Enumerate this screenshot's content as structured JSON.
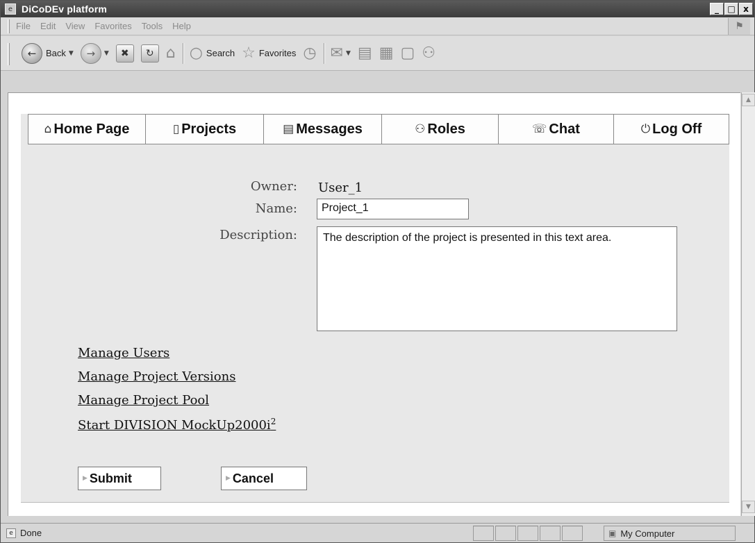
{
  "window": {
    "title": "DiCoDEv platform",
    "controls": {
      "minimize": "_",
      "restore": "□",
      "close": "x"
    }
  },
  "menu": [
    "File",
    "Edit",
    "View",
    "Favorites",
    "Tools",
    "Help"
  ],
  "toolbar": {
    "back_label": "Back",
    "search_label": "Search",
    "favorites_label": "Favorites"
  },
  "tabs": [
    {
      "label": "Home Page",
      "icon": "home-icon"
    },
    {
      "label": "Projects",
      "icon": "document-icon"
    },
    {
      "label": "Messages",
      "icon": "list-icon"
    },
    {
      "label": "Roles",
      "icon": "people-icon"
    },
    {
      "label": "Chat",
      "icon": "chat-icon"
    },
    {
      "label": "Log Off",
      "icon": "power-icon"
    }
  ],
  "form": {
    "owner_label": "Owner:",
    "owner_value": "User_1",
    "name_label": "Name:",
    "name_value": "Project_1",
    "description_label": "Description:",
    "description_value": "The description of the project is presented in this text area."
  },
  "links": {
    "manage_users": "Manage Users",
    "manage_versions": "Manage Project Versions",
    "manage_pool": "Manage Project Pool",
    "start_mockup": "Start DIVISION MockUp2000i",
    "start_mockup_sup": "2"
  },
  "buttons": {
    "submit": "Submit",
    "cancel": "Cancel"
  },
  "status": {
    "text": "Done",
    "zone": "My Computer"
  }
}
